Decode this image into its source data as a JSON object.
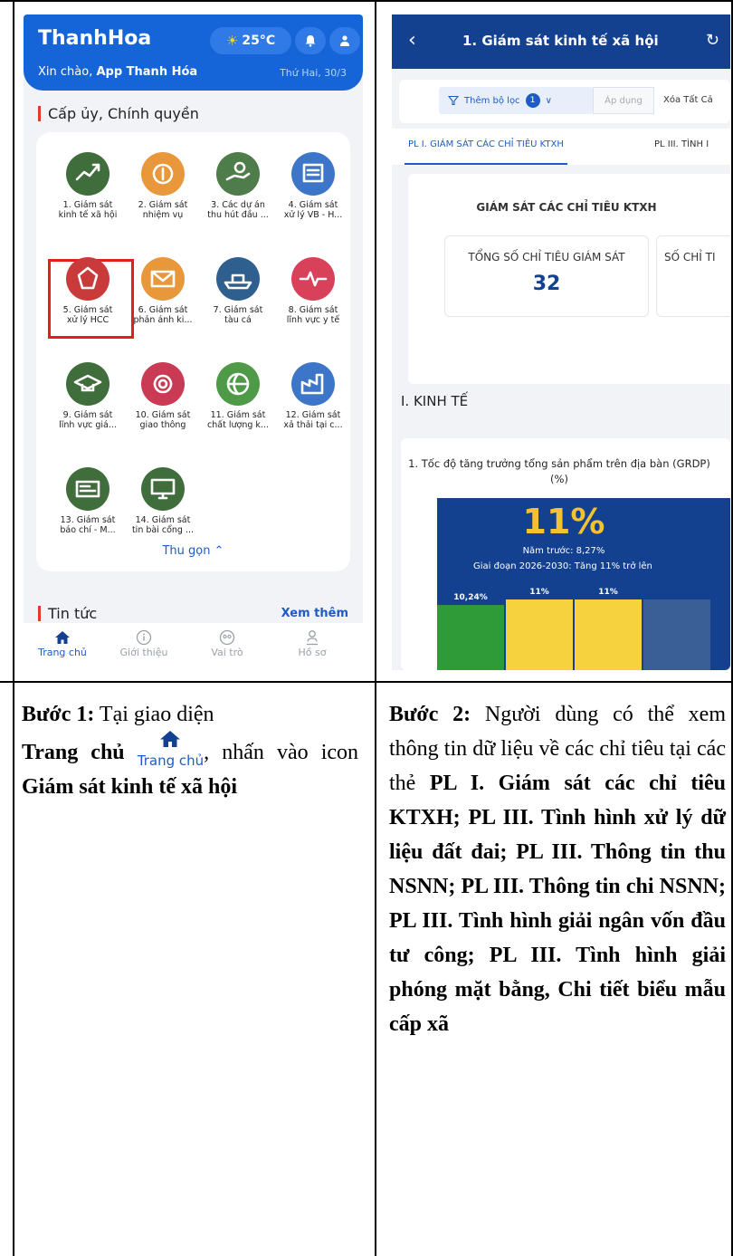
{
  "phone1": {
    "app_title": "ThanhHoa",
    "weather": "25°C",
    "greeting_prefix": "Xin chào, ",
    "greeting_name": "App Thanh Hóa",
    "date": "Thứ Hai, 30/3",
    "section_title": "Cấp ủy, Chính quyền",
    "grid": [
      {
        "label": "1. Giám sát\nkinh tế xã hội",
        "icon": "growth-chart-icon",
        "color": "#3f6e3c"
      },
      {
        "label": "2. Giám sát\nnhiệm vụ",
        "icon": "coin-task-icon",
        "color": "#e8973a"
      },
      {
        "label": "3. Các dự án\nthu hút đầu ...",
        "icon": "investment-hand-icon",
        "color": "#4e7c4a"
      },
      {
        "label": "4. Giám sát\nxử lý VB - H...",
        "icon": "document-tray-icon",
        "color": "#3d76c9"
      },
      {
        "label": "5. Giám sát\nxử lý HCC",
        "icon": "public-service-icon",
        "color": "#c93a3a"
      },
      {
        "label": "6. Giám sát\nphản ánh ki...",
        "icon": "feedback-mail-icon",
        "color": "#e8973a"
      },
      {
        "label": "7. Giám sát\ntàu cá",
        "icon": "fishing-boat-icon",
        "color": "#2f5f8f"
      },
      {
        "label": "8. Giám sát\nlĩnh vực y tế",
        "icon": "heartbeat-icon",
        "color": "#d9415a"
      },
      {
        "label": "9. Giám sát\nlĩnh vực giá...",
        "icon": "graduation-cap-icon",
        "color": "#3f6e3c"
      },
      {
        "label": "10. Giám sát\ngiao thông",
        "icon": "traffic-camera-icon",
        "color": "#c93a54"
      },
      {
        "label": "11. Giám sát\nchất lượng k...",
        "icon": "globe-leaf-icon",
        "color": "#4e9a48"
      },
      {
        "label": "12. Giám sát\nxả thải tại c...",
        "icon": "factory-icon",
        "color": "#3d76c9"
      },
      {
        "label": "13. Giám sát\nbáo chí - M...",
        "icon": "news-card-icon",
        "color": "#3f6e3c"
      },
      {
        "label": "14. Giám sát\ntin bài cổng ...",
        "icon": "monitor-icon",
        "color": "#3f6e3c"
      }
    ],
    "collapse": "Thu gọn",
    "news_title": "Tin tức",
    "see_more": "Xem thêm",
    "tabs": [
      "Trang chủ",
      "Giới thiệu",
      "Vai trò",
      "Hồ sơ"
    ]
  },
  "phone2": {
    "title": "1. Giám sát kinh tế xã hội",
    "filter_label": "Thêm bộ lọc",
    "filter_count": "1",
    "apply": "Áp dụng",
    "clear": "Xóa Tất Cả",
    "tab1": "PL I. GIÁM SÁT CÁC CHỈ TIÊU KTXH",
    "tab2": "PL III. TÌNH I",
    "card_title": "GIÁM SÁT CÁC CHỈ TIÊU KTXH",
    "total_label": "TỔNG SỐ CHỈ TIÊU GIÁM SÁT",
    "total_value": "32",
    "second_label": "SỐ CHỈ TI",
    "section": "I. KINH TẾ",
    "chart_title": "1. Tốc độ tăng trưởng tổng sản phẩm trên địa bàn (GRDP) (%)",
    "big_value": "11%",
    "prev_year": "Năm trước: 8,27%",
    "period": "Giai đoạn 2026-2030: Tăng 11% trở lên"
  },
  "chart_data": {
    "type": "bar",
    "title": "1. Tốc độ tăng trưởng tổng sản phẩm trên địa bàn (GRDP) (%)",
    "categories": [
      "",
      "",
      "",
      ""
    ],
    "values": [
      10.24,
      11,
      11,
      null
    ],
    "value_labels": [
      "10,24%",
      "11%",
      "11%",
      ""
    ],
    "colors": [
      "#2f9a38",
      "#f5d23e",
      "#f5d23e",
      "#3a5f96"
    ]
  },
  "steps": {
    "step1_label": "Bước 1:",
    "step1_a": " Tại giao diện ",
    "step1_b": "Trang chủ",
    "step1_home": "Trang chủ",
    "step1_c": ", nhấn vào icon ",
    "step1_d": "Giám sát kinh tế xã hội",
    "step2_label": "Bước 2:",
    "step2_a": " Người dùng có thể xem thông tin dữ liệu về các chỉ tiêu tại các thẻ ",
    "step2_b": "PL I. Giám sát các chỉ tiêu KTXH; PL III. Tình hình xử lý dữ liệu đất đai; PL III. Thông tin thu NSNN; PL III. Thông tin chi NSNN; PL III. Tình hình giải ngân vốn đầu tư công; PL III. Tình hình giải phóng mặt bằng, Chi tiết biểu mẫu cấp xã"
  }
}
